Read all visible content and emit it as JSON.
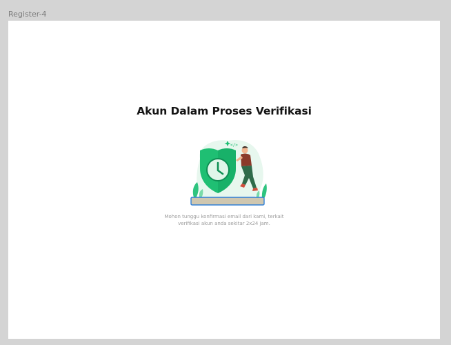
{
  "frame": {
    "label": "Register-4"
  },
  "page": {
    "title": "Akun Dalam Proses Verifikasi",
    "message_line1": "Mohon tunggu konfirmasi email dari kami, terkait",
    "message_line2": "verifikasi akun anda sekitar 2x24 jam."
  },
  "illustration": {
    "icon": "shield-clock-illustration",
    "accent_color": "#1fbf73",
    "placeholder_fill": "#cfc7b0",
    "placeholder_stroke": "#2f7fd6"
  }
}
